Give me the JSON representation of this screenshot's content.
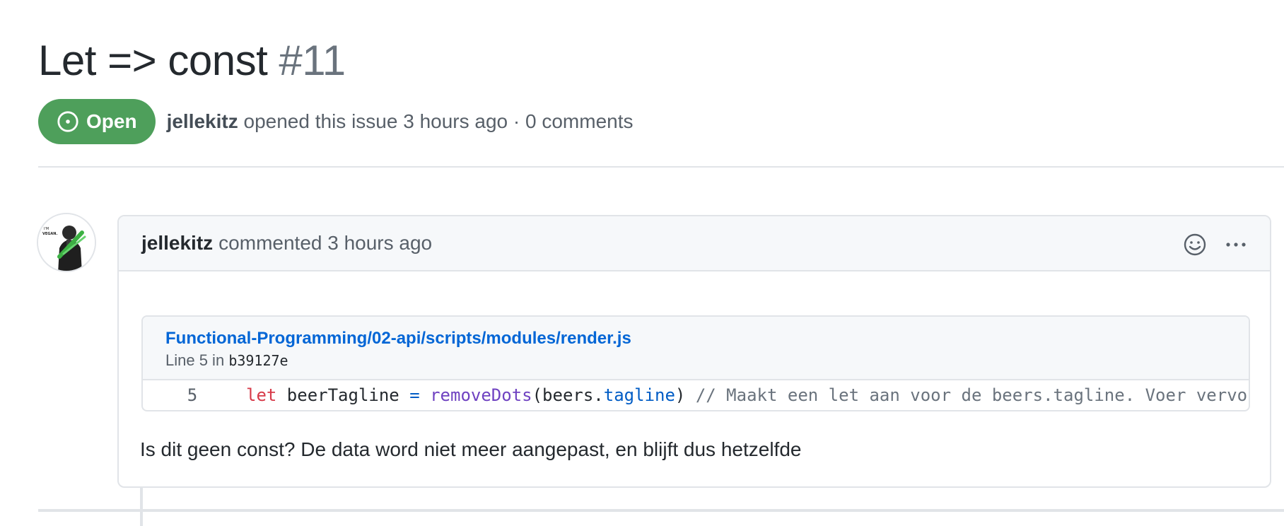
{
  "issue": {
    "title": "Let => const",
    "number": "#11",
    "state": "Open",
    "author": "jellekitz",
    "opened_text": "opened this issue 3 hours ago · 0 comments"
  },
  "comment": {
    "author": "jellekitz",
    "meta": "commented 3 hours ago",
    "actions": {
      "reaction_icon": "smiley-icon",
      "more_icon": "kebab-horizontal-icon"
    },
    "permalink": {
      "file_path": "Functional-Programming/02-api/scripts/modules/render.js",
      "line_prefix": "Line 5 in",
      "commit_sha": "b39127e",
      "line_number": "5",
      "code": {
        "kw": "let",
        "var": " beerTagline ",
        "op": "=",
        "space": " ",
        "fn": "removeDots",
        "paren_open": "(beers.",
        "prop": "tagline",
        "paren_close": ") ",
        "comment": "// Maakt een let aan voor de beers.tagline. Voer vervo"
      }
    },
    "body": "Is dit geen const? De data word niet meer aangepast, en blijft dus hetzelfde"
  },
  "colors": {
    "open_green": "#4e9f5b",
    "link_blue": "#0366d6",
    "border": "#e1e4e8"
  }
}
